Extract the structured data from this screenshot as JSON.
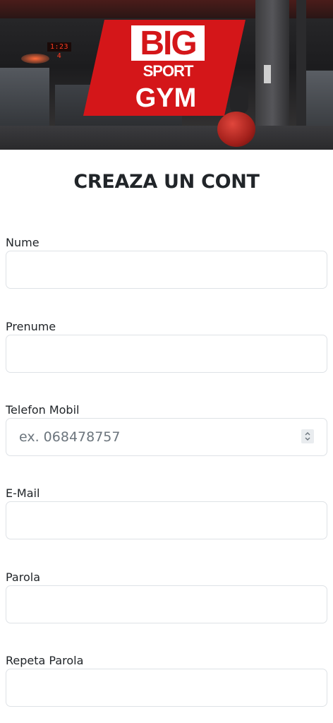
{
  "header": {
    "logo": {
      "line1": "BIG",
      "line2": "SPORT",
      "line3": "GYM",
      "brand_color": "#d41619"
    },
    "scoreboard_text": "1:23 4",
    "background": "gym-interior-photo"
  },
  "page": {
    "title": "CREAZA UN CONT"
  },
  "form": {
    "fields": [
      {
        "label": "Nume",
        "value": "",
        "placeholder": ""
      },
      {
        "label": "Prenume",
        "value": "",
        "placeholder": ""
      },
      {
        "label": "Telefon Mobil",
        "value": "",
        "placeholder": "ex. 068478757",
        "icon": "number-spinner-icon"
      },
      {
        "label": "E-Mail",
        "value": "",
        "placeholder": ""
      },
      {
        "label": "Parola",
        "value": "",
        "placeholder": ""
      },
      {
        "label": "Repeta Parola",
        "value": "",
        "placeholder": ""
      }
    ]
  }
}
